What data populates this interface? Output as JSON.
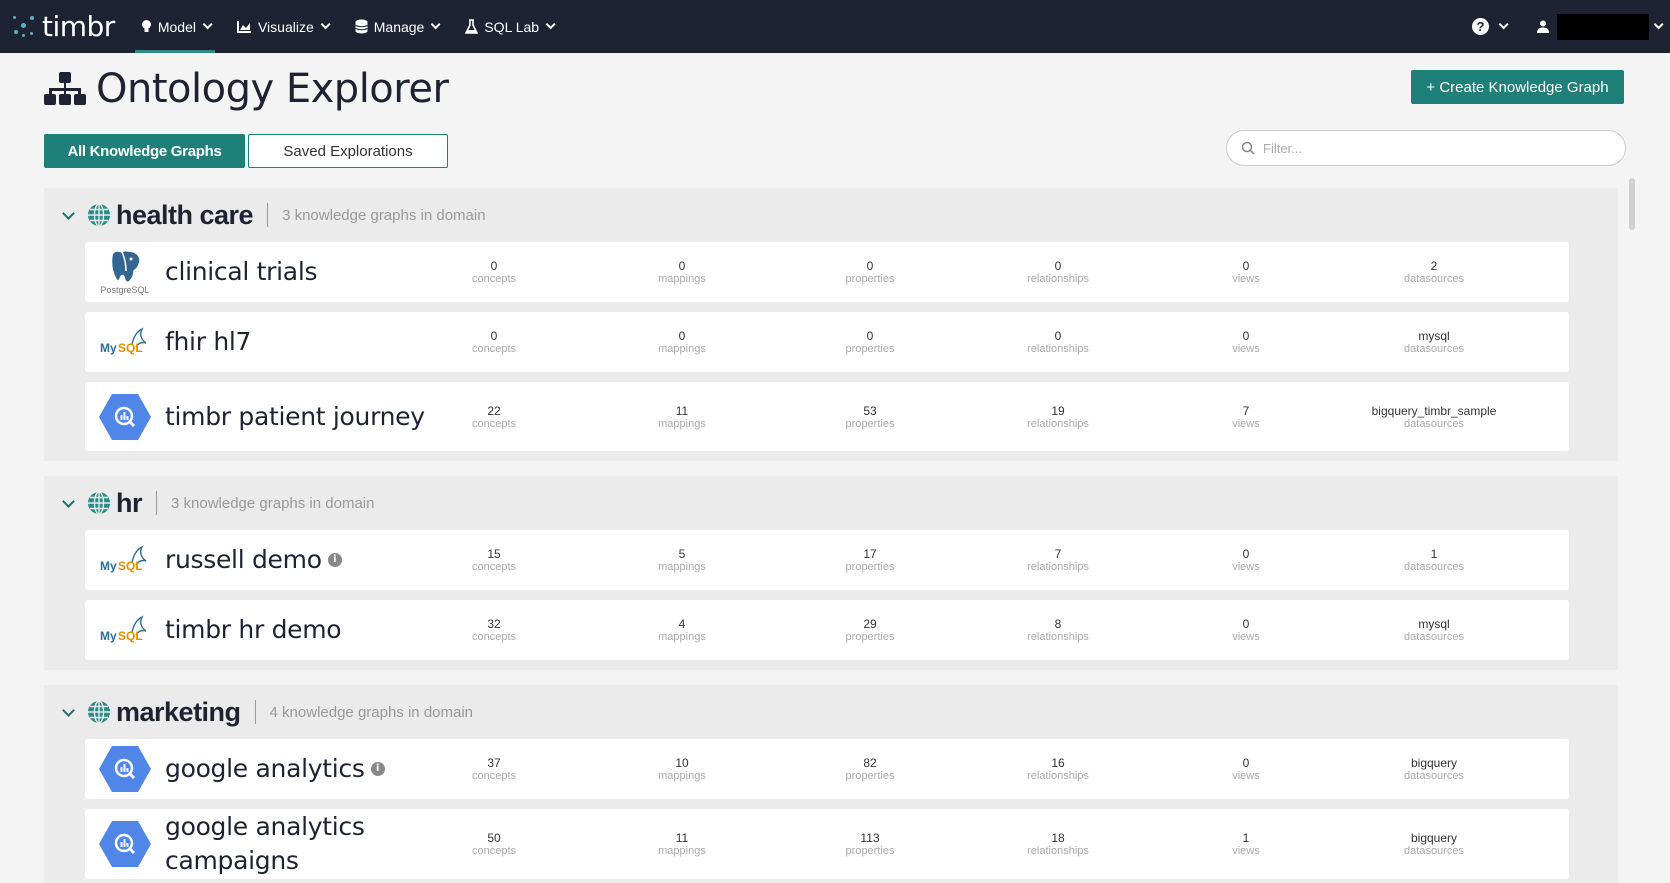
{
  "brand": {
    "name": "timbr"
  },
  "nav": {
    "items": [
      {
        "label": "Model",
        "icon": "bulb-icon"
      },
      {
        "label": "Visualize",
        "icon": "chart-icon"
      },
      {
        "label": "Manage",
        "icon": "database-icon"
      },
      {
        "label": "SQL Lab",
        "icon": "flask-icon"
      }
    ],
    "help": "?"
  },
  "page": {
    "title": "Ontology Explorer",
    "create_button": "+ Create Knowledge Graph",
    "tabs": {
      "all": "All Knowledge Graphs",
      "saved": "Saved Explorations"
    },
    "filter_placeholder": "Filter..."
  },
  "stat_labels": [
    "concepts",
    "mappings",
    "properties",
    "relationships",
    "views",
    "datasources"
  ],
  "domains": [
    {
      "name": "health care",
      "count": "3 knowledge graphs in domain",
      "graphs": [
        {
          "name": "clinical trials",
          "logo": "postgresql",
          "logo_caption": "PostgreSQL",
          "stats": [
            "0",
            "0",
            "0",
            "0",
            "0",
            "2"
          ]
        },
        {
          "name": "fhir hl7",
          "logo": "mysql",
          "stats": [
            "0",
            "0",
            "0",
            "0",
            "0",
            "mysql"
          ]
        },
        {
          "name": "timbr patient journey",
          "logo": "bigquery",
          "stats": [
            "22",
            "11",
            "53",
            "19",
            "7",
            "bigquery_timbr_sample"
          ]
        }
      ]
    },
    {
      "name": "hr",
      "count": "3 knowledge graphs in domain",
      "graphs": [
        {
          "name": "russell demo",
          "logo": "mysql",
          "info": "i",
          "stats": [
            "15",
            "5",
            "17",
            "7",
            "0",
            "1"
          ]
        },
        {
          "name": "timbr hr demo",
          "logo": "mysql",
          "stats": [
            "32",
            "4",
            "29",
            "8",
            "0",
            "mysql"
          ]
        }
      ]
    },
    {
      "name": "marketing",
      "count": "4 knowledge graphs in domain",
      "graphs": [
        {
          "name": "google analytics",
          "logo": "bigquery",
          "info": "i",
          "stats": [
            "37",
            "10",
            "82",
            "16",
            "0",
            "bigquery"
          ]
        },
        {
          "name": "google analytics campaigns",
          "logo": "bigquery",
          "stats": [
            "50",
            "11",
            "113",
            "18",
            "1",
            "bigquery"
          ]
        }
      ]
    }
  ],
  "colors": {
    "nav_bg": "#1d2333",
    "accent": "#1f8079",
    "bigquery": "#4f86e8",
    "mysql_blue": "#2d6e95",
    "mysql_orange": "#e48e00"
  },
  "logo_text": {
    "mysql_my": "My",
    "mysql_sql": "SQL"
  }
}
